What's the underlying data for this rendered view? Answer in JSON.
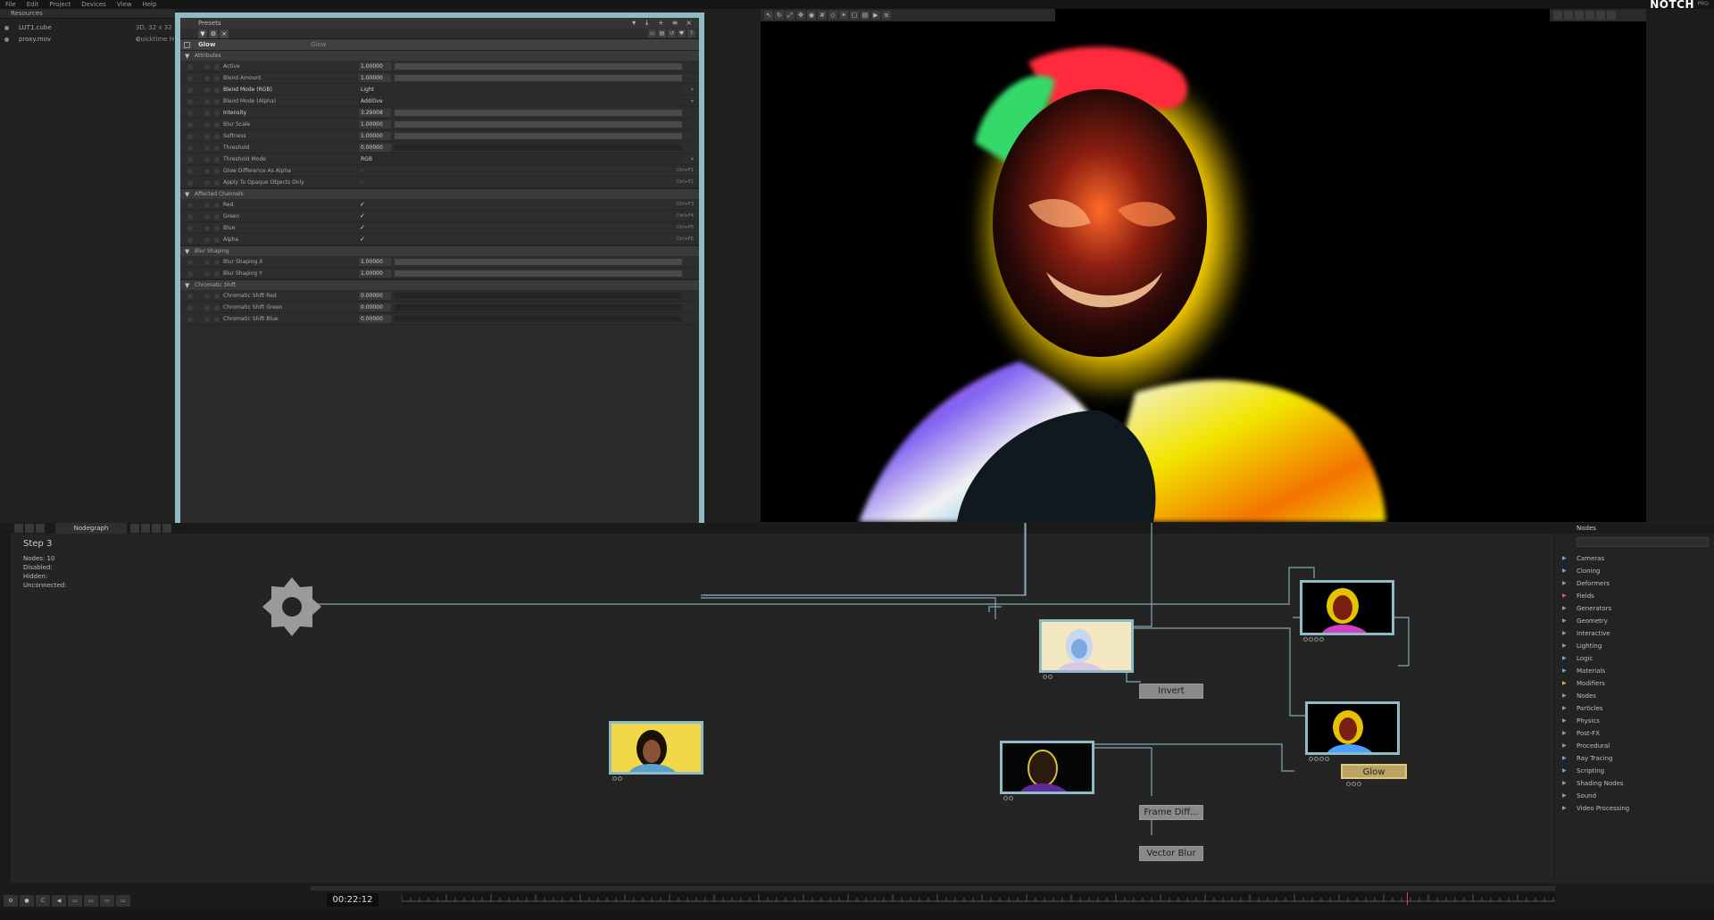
{
  "menu": [
    "File",
    "Edit",
    "Project",
    "Devices",
    "View",
    "Help"
  ],
  "brand": {
    "name": "NOTCH",
    "edition": "PRO"
  },
  "resources": {
    "tab": "Resources",
    "items": [
      {
        "name": "LUT1.cube",
        "type": "3D, 32 x 32 x"
      },
      {
        "name": "proxy.mov",
        "type": "Quicktime H"
      }
    ]
  },
  "properties": {
    "title": "Presets",
    "node_name": "Glow",
    "node_type": "Glow",
    "sections": [
      {
        "title": "Attributes",
        "rows": [
          {
            "label": "Active",
            "value": "1.00000",
            "kind": "slider"
          },
          {
            "label": "Blend Amount",
            "value": "1.00000",
            "kind": "slider"
          },
          {
            "label": "Blend Mode (RGB)",
            "value": "Light",
            "kind": "dropdown",
            "bright": true
          },
          {
            "label": "Blend Mode (Alpha)",
            "value": "Additive",
            "kind": "dropdown"
          },
          {
            "label": "Intensity",
            "value": "3.29008",
            "kind": "slider",
            "bright": true
          },
          {
            "label": "Blur Scale",
            "value": "1.00000",
            "kind": "slider"
          },
          {
            "label": "Softness",
            "value": "1.00000",
            "kind": "slider"
          },
          {
            "label": "Threshold",
            "value": "0.00000",
            "kind": "slider-empty"
          },
          {
            "label": "Threshold Mode",
            "value": "RGB",
            "kind": "dropdown"
          },
          {
            "label": "Glow Difference As Alpha",
            "value": "",
            "kind": "check-off",
            "shortcut": "Ctrl+F1"
          },
          {
            "label": "Apply To Opaque Objects Only",
            "value": "",
            "kind": "check-off",
            "shortcut": "Ctrl+F2"
          }
        ]
      },
      {
        "title": "Affected Channels",
        "rows": [
          {
            "label": "Red",
            "value": "✓",
            "kind": "check",
            "shortcut": "Ctrl+F3"
          },
          {
            "label": "Green",
            "value": "✓",
            "kind": "check",
            "shortcut": "Ctrl+F4"
          },
          {
            "label": "Blue",
            "value": "✓",
            "kind": "check",
            "shortcut": "Ctrl+F5"
          },
          {
            "label": "Alpha",
            "value": "✓",
            "kind": "check",
            "shortcut": "Ctrl+F6"
          }
        ]
      },
      {
        "title": "Blur Shaping",
        "rows": [
          {
            "label": "Blur Shaping X",
            "value": "1.00000",
            "kind": "slider"
          },
          {
            "label": "Blur Shaping Y",
            "value": "1.00000",
            "kind": "slider"
          }
        ]
      },
      {
        "title": "Chromatic Shift",
        "rows": [
          {
            "label": "Chromatic Shift Red",
            "value": "0.00000",
            "kind": "slider-empty"
          },
          {
            "label": "Chromatic Shift Green",
            "value": "0.00000",
            "kind": "slider-empty"
          },
          {
            "label": "Chromatic Shift Blue",
            "value": "0.00000",
            "kind": "slider-empty"
          }
        ]
      }
    ]
  },
  "nodegraph": {
    "tab": "Nodegraph",
    "title": "Step 3",
    "stats": [
      "Nodes: 10",
      "Disabled:",
      "Hidden:",
      "Unconnected:"
    ],
    "labels": {
      "invert": "Invert",
      "glow": "Glow",
      "frame_diff": "Frame Diff...",
      "vector_blur": "Vector Blur"
    }
  },
  "nodes_panel": {
    "title": "Nodes",
    "items": [
      "Cameras",
      "Cloning",
      "Deformers",
      "Fields",
      "Generators",
      "Geometry",
      "Interactive",
      "Lighting",
      "Logic",
      "Materials",
      "Modifiers",
      "Nodes",
      "Particles",
      "Physics",
      "Post-FX",
      "Procedural",
      "Ray Tracing",
      "Scripting",
      "Shading Nodes",
      "Sound",
      "Video Processing"
    ]
  },
  "timeline": {
    "time": "00:22:12"
  },
  "colors": {
    "accent": "#8fbcc4",
    "selected": "#e0c67a"
  }
}
